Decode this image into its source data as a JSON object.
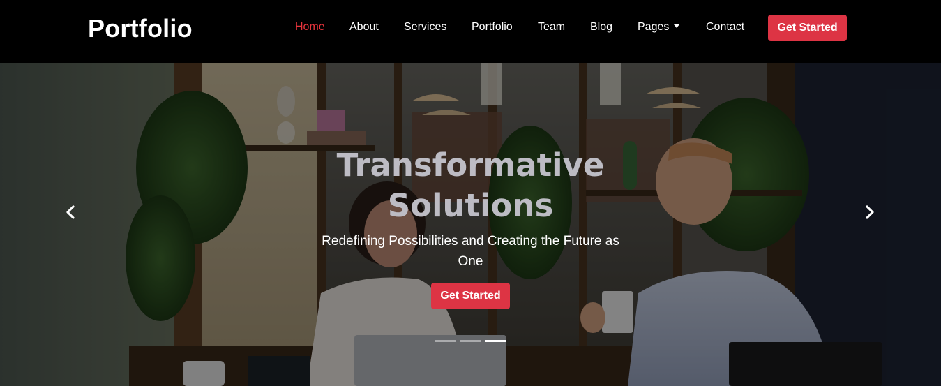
{
  "header": {
    "brand": "Portfolio",
    "nav": [
      {
        "label": "Home",
        "active": true
      },
      {
        "label": "About",
        "active": false
      },
      {
        "label": "Services",
        "active": false
      },
      {
        "label": "Portfolio",
        "active": false
      },
      {
        "label": "Team",
        "active": false
      },
      {
        "label": "Blog",
        "active": false
      },
      {
        "label": "Pages",
        "active": false,
        "dropdown": true
      },
      {
        "label": "Contact",
        "active": false
      }
    ],
    "cta_label": "Get Started"
  },
  "hero": {
    "title_line1": "Transformative",
    "title_line2": "Solutions",
    "subtitle": "Redefining Possibilities and Creating the Future as One",
    "cta_label": "Get Started",
    "prev_icon": "chevron-left-icon",
    "next_icon": "chevron-right-icon",
    "slide_count": 3,
    "active_slide": 3
  },
  "colors": {
    "accent": "#dd3444",
    "active_nav": "#e8343c",
    "header_bg": "#000000",
    "title_text": "#bdbcc4"
  }
}
